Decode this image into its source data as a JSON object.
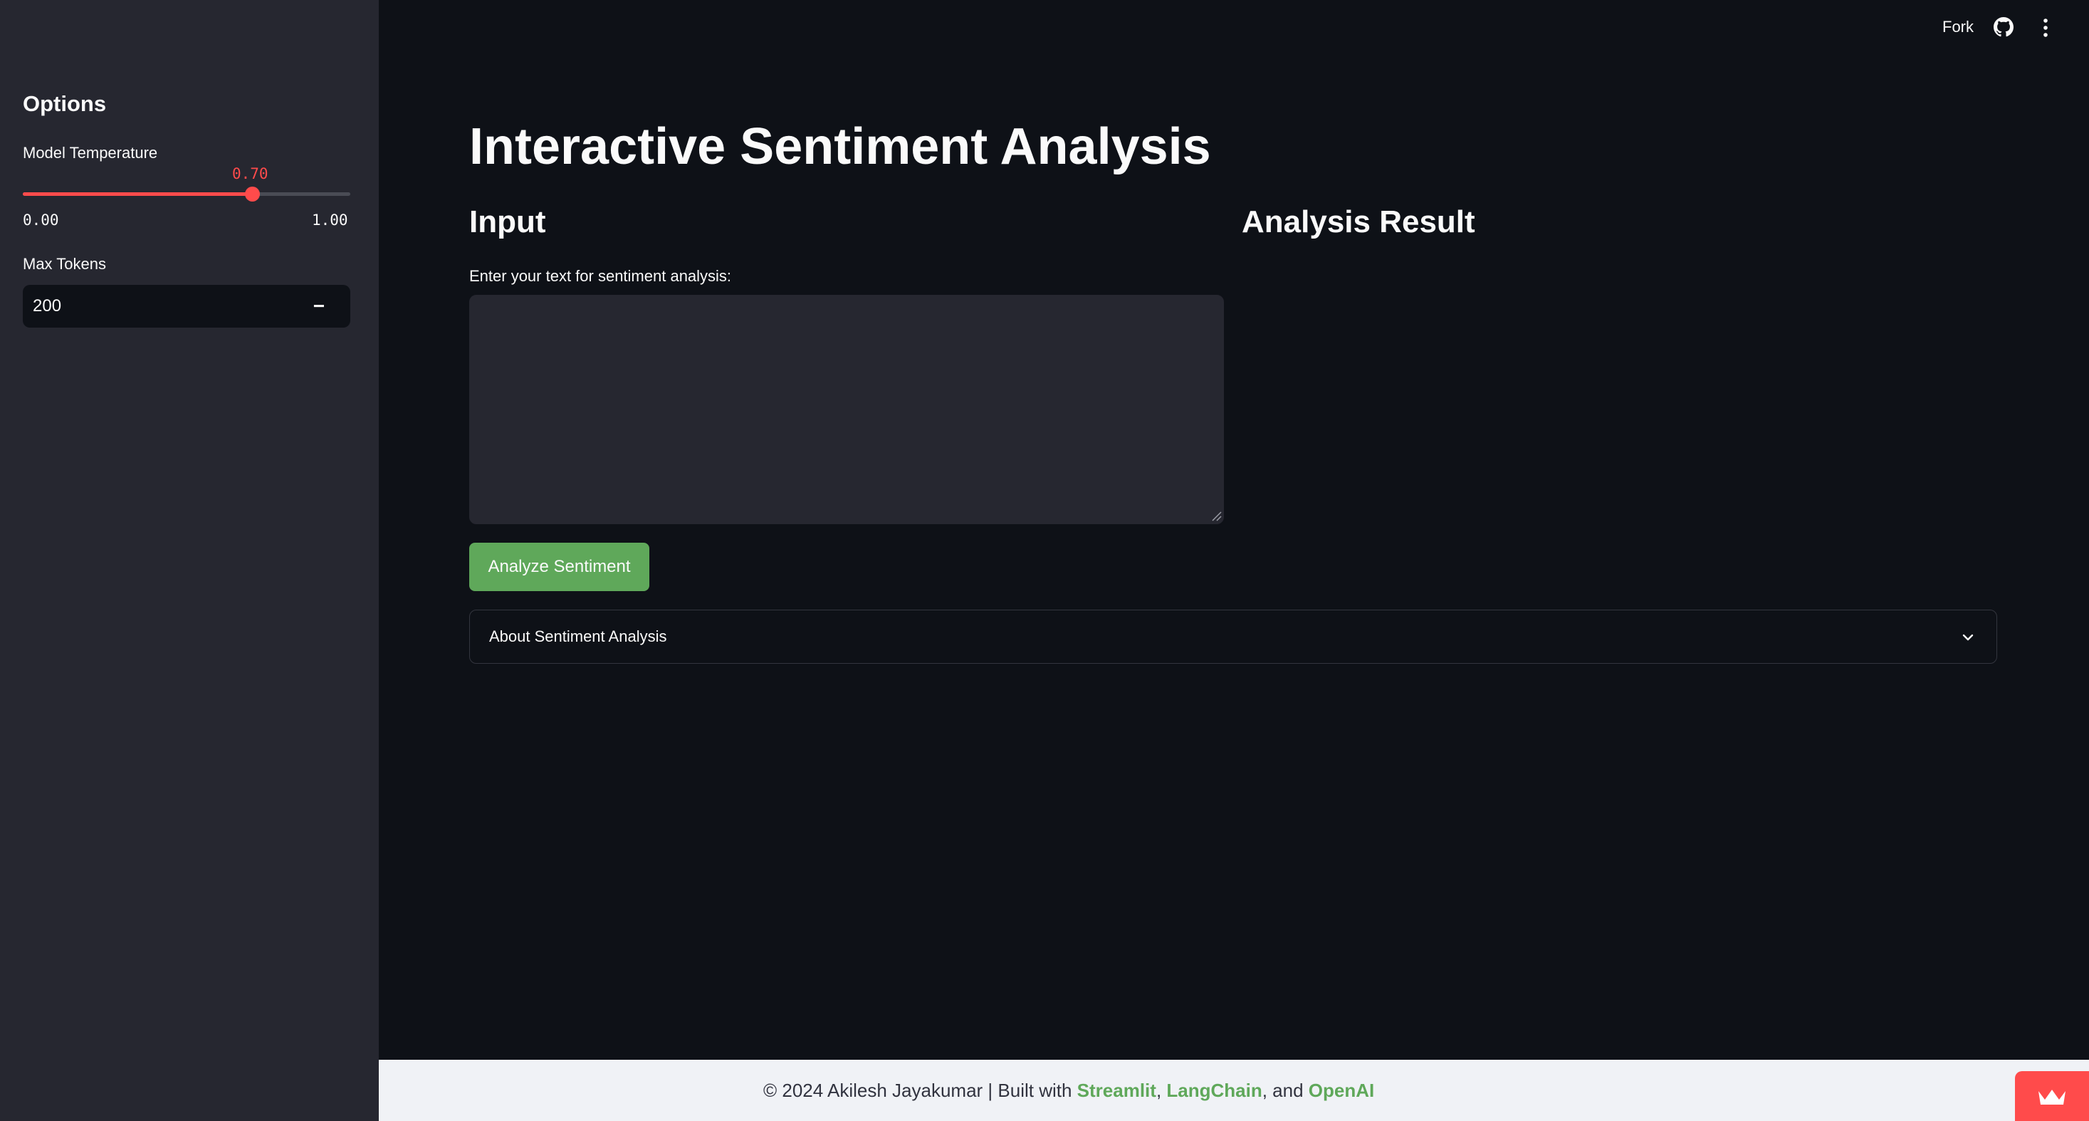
{
  "sidebar": {
    "title": "Options",
    "temperature": {
      "label": "Model Temperature",
      "value": 0.7,
      "value_text": "0.70",
      "min_text": "0.00",
      "max_text": "1.00",
      "min": 0.0,
      "max": 1.0
    },
    "max_tokens": {
      "label": "Max Tokens",
      "value": "200",
      "decrement_label": "−",
      "increment_label": "+"
    }
  },
  "header": {
    "fork_label": "Fork",
    "github_icon": "github-icon",
    "menu_icon": "kebab-menu-icon"
  },
  "main": {
    "title": "Interactive Sentiment Analysis",
    "input_heading": "Input",
    "result_heading": "Analysis Result",
    "textarea_label": "Enter your text for sentiment analysis:",
    "textarea_value": "",
    "analyze_button": "Analyze Sentiment",
    "expander_label": "About Sentiment Analysis"
  },
  "footer": {
    "prefix": "© 2024 Akilesh Jayakumar | Built with ",
    "link1": "Streamlit",
    "sep1": ", ",
    "link2": "LangChain",
    "sep2": ", and ",
    "link3": "OpenAI"
  },
  "colors": {
    "accent": "#ff4b4b",
    "button_green": "#5fa85a",
    "sidebar_bg": "#262730",
    "main_bg": "#0e1117",
    "footer_bg": "#f0f2f6"
  }
}
